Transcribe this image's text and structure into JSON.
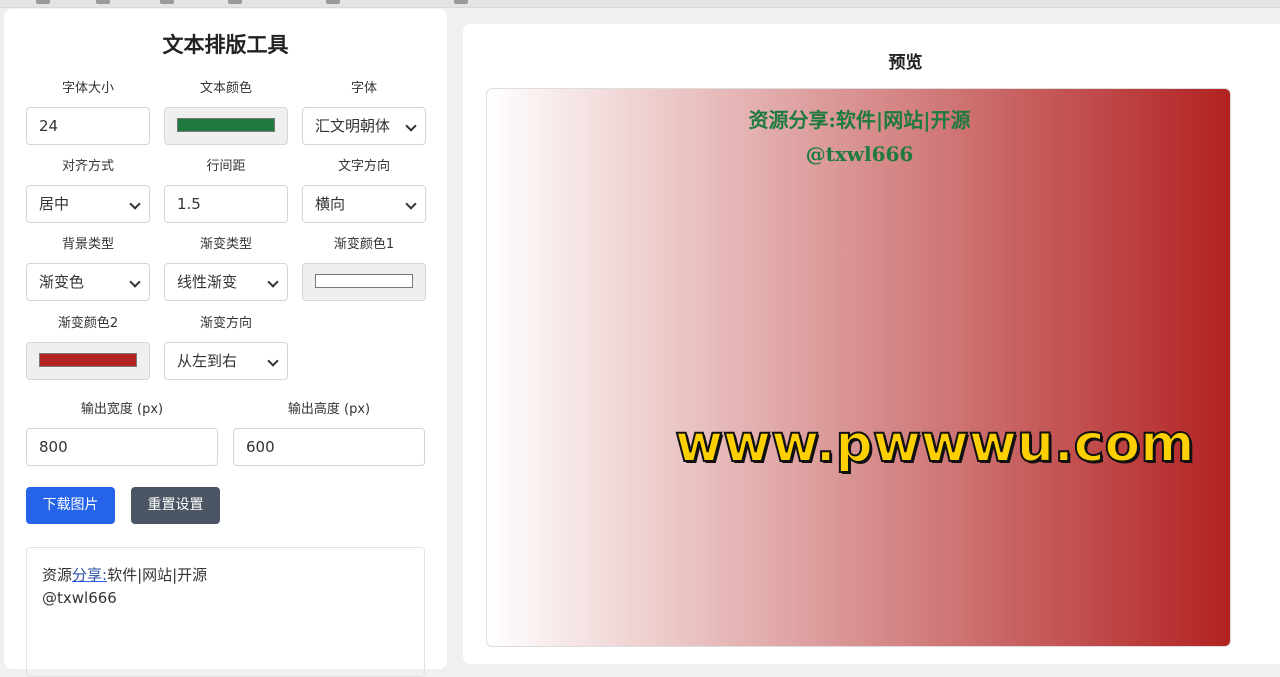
{
  "app": {
    "title": "文本排版工具",
    "preview_title": "预览"
  },
  "fields": {
    "font_size": {
      "label": "字体大小",
      "value": "24"
    },
    "text_color": {
      "label": "文本颜色",
      "value": "#1e7a3e"
    },
    "font_family": {
      "label": "字体",
      "value": "汇文明朝体"
    },
    "align": {
      "label": "对齐方式",
      "value": "居中"
    },
    "line_height": {
      "label": "行间距",
      "value": "1.5"
    },
    "direction": {
      "label": "文字方向",
      "value": "横向"
    },
    "bg_type": {
      "label": "背景类型",
      "value": "渐变色"
    },
    "gradient_type": {
      "label": "渐变类型",
      "value": "线性渐变"
    },
    "gradient_color1": {
      "label": "渐变颜色1",
      "value": "#ffffff"
    },
    "gradient_color2": {
      "label": "渐变颜色2",
      "value": "#b22222"
    },
    "gradient_dir": {
      "label": "渐变方向",
      "value": "从左到右"
    },
    "out_width": {
      "label": "输出宽度 (px)",
      "value": "800"
    },
    "out_height": {
      "label": "输出高度 (px)",
      "value": "600"
    }
  },
  "buttons": {
    "download": "下载图片",
    "reset": "重置设置"
  },
  "text_input": {
    "line1_a": "资源",
    "line1_link": "分享:",
    "line1_b": "软件|网站|开源",
    "line2": "@txwl666"
  },
  "preview": {
    "line1": "资源分享:软件|网站|开源",
    "line2": "@txwl666",
    "watermark": "www.pwwwu.com"
  },
  "colors": {
    "primary": "#2563eb",
    "secondary": "#4b5563"
  },
  "icons": {
    "select_arrow": "chevron-down-icon"
  }
}
